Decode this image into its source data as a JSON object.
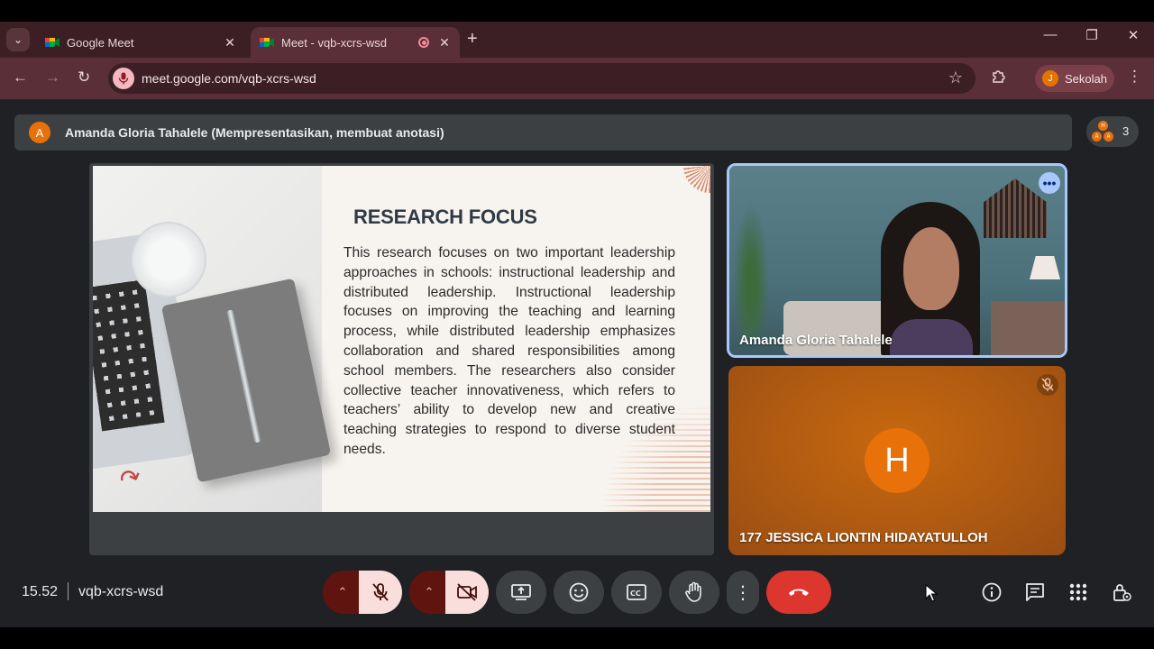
{
  "browser": {
    "tabs": [
      {
        "title": "Google Meet",
        "active": false
      },
      {
        "title": "Meet - vqb-xcrs-wsd",
        "active": true,
        "recording": true
      }
    ],
    "url": "meet.google.com/vqb-xcrs-wsd",
    "profile": {
      "initial": "J",
      "name": "Sekolah",
      "color": "#e37400"
    },
    "icons": [
      "tab-search-icon",
      "back-icon",
      "forward-icon",
      "reload-icon",
      "mic-icon",
      "star-icon",
      "extensions-icon",
      "menu-icon",
      "minimize-icon",
      "restore-icon",
      "close-icon"
    ]
  },
  "meet": {
    "presenter": {
      "initial": "A",
      "text": "Amanda Gloria Tahalele (Mempresentasikan, membuat anotasi)"
    },
    "participants": {
      "initials": [
        "H",
        "A",
        "A"
      ],
      "count": "3"
    },
    "slide": {
      "title": "RESEARCH FOCUS",
      "body": "This research focuses on two important leadership approaches in schools: instructional leadership and distributed leadership. Instructional leadership focuses on improving the teaching and learning process, while distributed leadership emphasizes collaboration and shared responsibilities among school members. The researchers also consider collective teacher innovativeness, which refers to teachers’ ability to develop new and creative teaching strategies to respond to diverse student needs."
    },
    "tiles": [
      {
        "name": "Amanda Gloria Tahalele",
        "speaking": true
      },
      {
        "name": "177 JESSICA LIONTIN HIDAYATULLOH",
        "initial": "H",
        "muted": true,
        "color": "#e8710a"
      }
    ],
    "time": "15.52",
    "meeting_code": "vqb-xcrs-wsd",
    "controls": [
      "mic-muted",
      "camera-off",
      "present",
      "emoji",
      "captions",
      "raise-hand",
      "more-options",
      "leave-call"
    ],
    "side_controls": [
      "info",
      "chat",
      "activities",
      "host-controls"
    ],
    "colors": {
      "accent": "#a8c7fa",
      "end_call": "#dc362e",
      "muted_bg": "#f9dedc"
    }
  }
}
